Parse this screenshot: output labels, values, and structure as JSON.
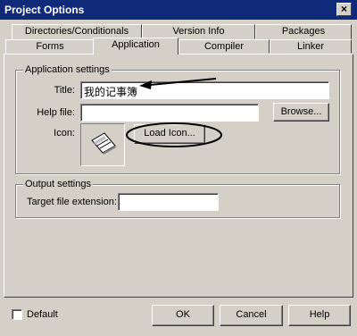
{
  "window": {
    "title": "Project Options",
    "close_glyph": "×"
  },
  "tabs_row1": [
    "Directories/Conditionals",
    "Version Info",
    "Packages"
  ],
  "tabs_row2": [
    "Forms",
    "Application",
    "Compiler",
    "Linker"
  ],
  "active_tab": "Application",
  "app_settings": {
    "group_title": "Application settings",
    "title_label": "Title:",
    "title_value": "我的记事簿",
    "help_label": "Help file:",
    "help_value": "",
    "browse_label": "Browse...",
    "icon_label": "Icon:",
    "load_icon_label": "Load Icon..."
  },
  "output_settings": {
    "group_title": "Output settings",
    "ext_label": "Target file extension:",
    "ext_value": ""
  },
  "footer": {
    "default_label": "Default",
    "default_checked": false,
    "ok_label": "OK",
    "cancel_label": "Cancel",
    "help_label": "Help"
  }
}
